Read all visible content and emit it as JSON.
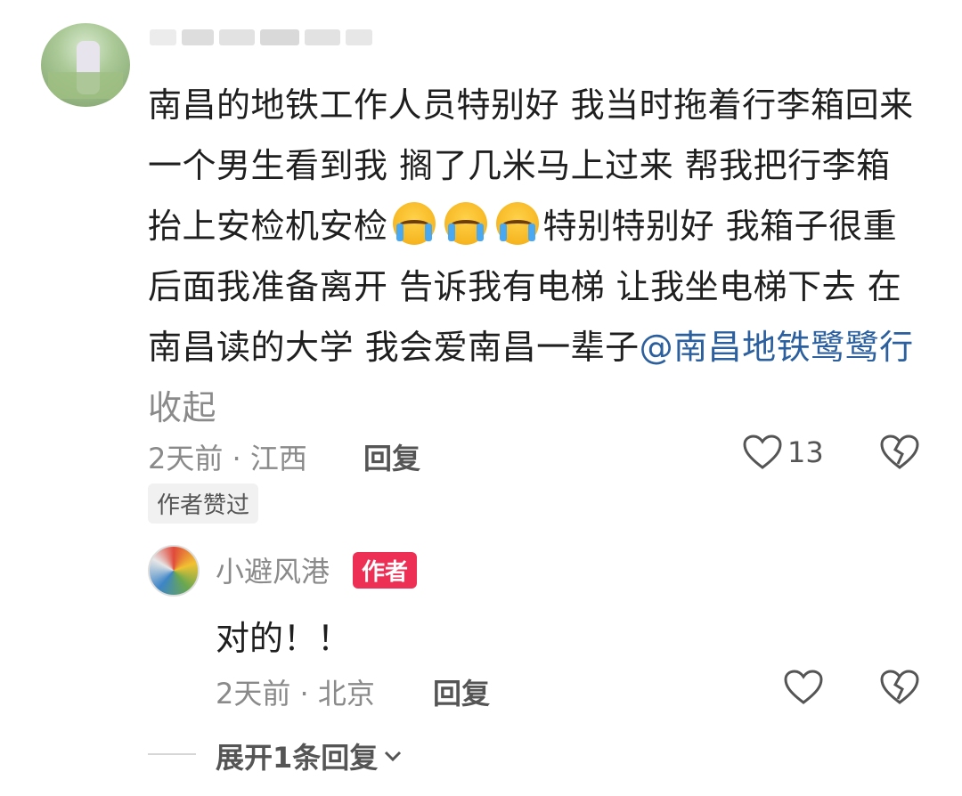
{
  "comment": {
    "username_blurred": "",
    "text_main": "南昌的地铁工作人员特别好 我当时拖着行李箱回来 一个男生看到我 搁了几米马上过来 帮我把行李箱抬上安检机安检",
    "emoji_1": "crying-face-emoji",
    "emoji_2": "crying-face-emoji",
    "emoji_3": "crying-face-emoji",
    "text_after_emoji": "特别特别好 我箱子很重 后面我准备离开 告诉我有电梯 让我坐电梯下去 在南昌读的大学 我会爱南昌一辈子",
    "mention": "@南昌地铁鹭鹭行",
    "collapse_label": "收起",
    "time_location": "2天前 · 江西",
    "reply_label": "回复",
    "like_count": "13",
    "author_liked_badge": "作者赞过"
  },
  "reply": {
    "username": "小避风港",
    "author_badge": "作者",
    "text": "对的！！",
    "time_location": "2天前 · 北京",
    "reply_label": "回复"
  },
  "expand_replies_label": "展开1条回复",
  "colors": {
    "mention": "#2b5f9e",
    "author_badge_bg": "#ee2f55",
    "meta_text": "#8a8a8a"
  }
}
